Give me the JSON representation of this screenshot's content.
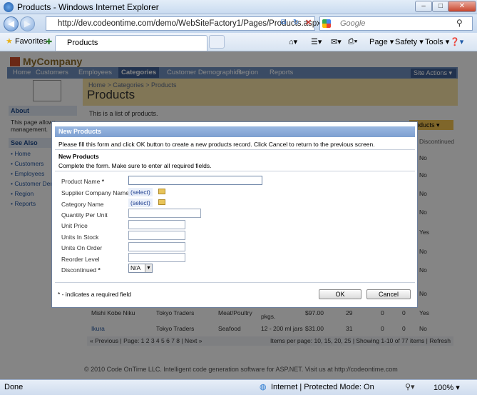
{
  "window": {
    "title": "Products - Windows Internet Explorer"
  },
  "address": {
    "url": "http://dev.codeontime.com/demo/WebSiteFactory1/Pages/Products.aspx",
    "search_placeholder": "Google"
  },
  "favorites": {
    "label": "Favorites",
    "tab_title": "Products"
  },
  "commandbar": {
    "page": "Page",
    "safety": "Safety",
    "tools": "Tools"
  },
  "site": {
    "logo": "MyCompany",
    "menu": [
      "Home",
      "Customers",
      "Employees",
      "Categories",
      "Customer Demographics",
      "Region",
      "Reports"
    ],
    "site_actions": "Site Actions",
    "breadcrumb": "Home  >  Categories  >  Products",
    "page_title": "Products",
    "description": "This is a list of products.",
    "about_title": "About",
    "about_text": "This page allows ... management.",
    "see_also_title": "See Also",
    "see_also": [
      "Home",
      "Customers",
      "Employees",
      "Customer Demo",
      "Region",
      "Reports"
    ],
    "actions_button": "roducts",
    "column_header": "Discontinued",
    "discontinued_values": [
      "No",
      "No",
      "No",
      "No",
      "Yes",
      "No",
      "No",
      "No",
      "No",
      "No"
    ],
    "row_partial": {
      "product": "Mishi Kobe Niku",
      "supplier": "Tokyo Traders",
      "category": "Meat/Poultry",
      "qty": "pkgs.",
      "price": "$97.00",
      "stock": "29",
      "order": "0",
      "reorder": "0",
      "disc": "Yes"
    },
    "row_last": {
      "product": "Ikura",
      "supplier": "Tokyo Traders",
      "category": "Seafood",
      "qty": "12 - 200 ml jars",
      "price": "$31.00",
      "stock": "31",
      "order": "0",
      "reorder": "0",
      "disc": "No"
    },
    "pager": "« Previous  | Page: 1 2 3 4 5 6 7 8 | Next »",
    "pager_right": "Items per page: 10, 15, 20, 25 | Showing 1-10 of 77 items | Refresh",
    "footer": "© 2010 Code OnTime LLC. Intelligent code generation software for ASP.NET. Visit us at http://codeontime.com"
  },
  "dialog": {
    "title": "New Products",
    "intro": "Please fill this form and click OK button to create a new products record. Click Cancel to return to the previous screen.",
    "section_title": "New Products",
    "section_desc": "Complete the form. Make sure to enter all required fields.",
    "fields": {
      "product_name": "Product Name",
      "supplier": "Supplier Company Name",
      "category": "Category Name",
      "qty": "Quantity Per Unit",
      "unit_price": "Unit Price",
      "units_in_stock": "Units In Stock",
      "units_on_order": "Units On Order",
      "reorder_level": "Reorder Level",
      "discontinued": "Discontinued"
    },
    "required_mark": "*",
    "select_link": "(select)",
    "discontinued_value": "N/A",
    "required_note": "* - indicates a required field",
    "ok": "OK",
    "cancel": "Cancel"
  },
  "status": {
    "left": "Done",
    "zone": "Internet | Protected Mode: On",
    "zoom": "100%"
  }
}
